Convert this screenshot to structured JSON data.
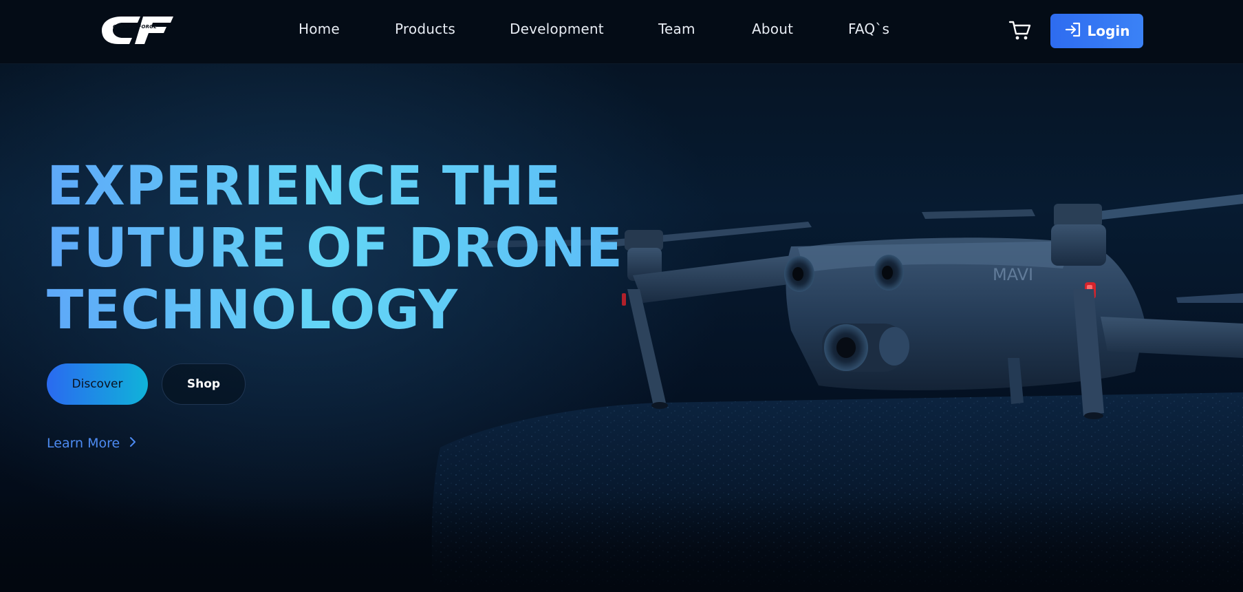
{
  "header": {
    "logo": {
      "letters": "CF",
      "tagline": "CYBORG FORGE"
    },
    "nav": [
      {
        "label": "Home"
      },
      {
        "label": "Products"
      },
      {
        "label": "Development"
      },
      {
        "label": "Team"
      },
      {
        "label": "About"
      },
      {
        "label": "FAQ`s"
      }
    ],
    "cart_icon": "cart-icon",
    "login": {
      "label": "Login",
      "icon": "login-arrow-icon"
    }
  },
  "hero": {
    "title_lines": [
      "EXPERIENCE THE",
      "FUTURE OF DRONE",
      "TECHNOLOGY"
    ],
    "discover_label": "Discover",
    "shop_label": "Shop",
    "learn_more_label": "Learn More",
    "learn_more_icon": "chevron-right-icon",
    "drone_marking": "MAVI"
  },
  "colors": {
    "background": "#040c16",
    "accent_blue": "#3b82f6",
    "title_gradient_start": "#5ea8f8",
    "title_gradient_mid": "#63d6f6",
    "discover_gradient_end": "#10b3d9",
    "link_blue": "#4d8bf2"
  }
}
